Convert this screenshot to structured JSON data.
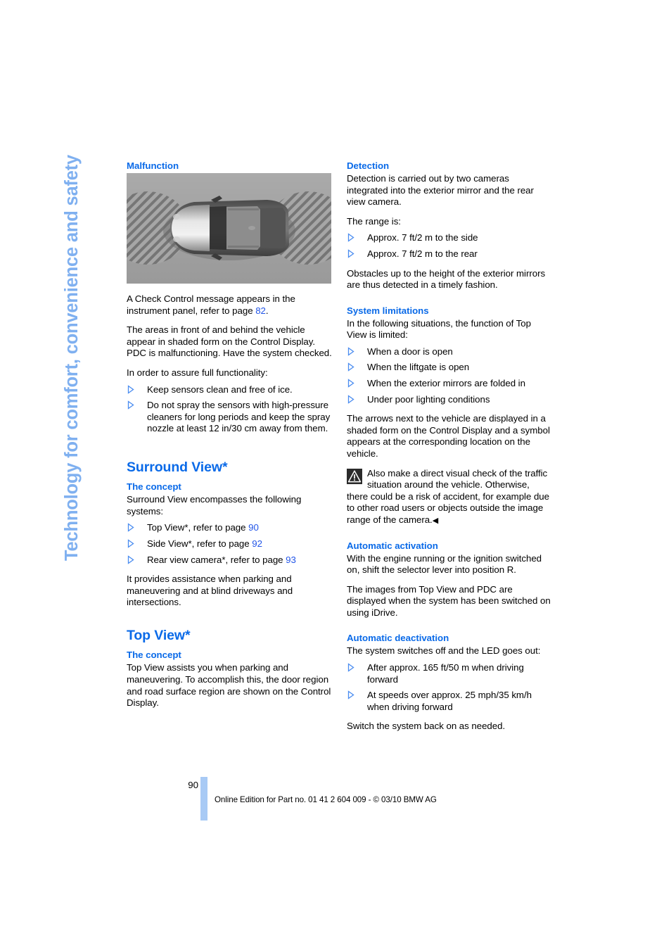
{
  "sidebar": {
    "chapter_title": "Technology for comfort, convenience and safety",
    "color": "#7fb0f0"
  },
  "theme": {
    "heading_blue": "#0a6ae8",
    "link_blue": "#2255e8",
    "folio_bar_blue": "#a8caf5"
  },
  "left_column": {
    "malfunction": {
      "heading": "Malfunction",
      "figure_alt": "Top-down view of vehicle with hatched detection zones in front and behind",
      "paragraph_1_pre": "A Check Control message appears in the instrument panel, refer to page ",
      "paragraph_1_link": "82",
      "paragraph_1_post": ".",
      "paragraph_2": "The areas in front of and behind the vehicle appear in shaded form on the Control Display. PDC is malfunctioning. Have the system checked.",
      "paragraph_3": "In order to assure full functionality:",
      "bullets": [
        "Keep sensors clean and free of ice.",
        "Do not spray the sensors with high-pressure cleaners for long periods and keep the spray nozzle at least 12 in/30 cm away from them."
      ]
    },
    "surround_view": {
      "heading": "Surround View*",
      "sub_heading": "The concept",
      "intro": "Surround View encompasses the following systems:",
      "bullets": [
        {
          "text_pre": "Top View*, refer to page ",
          "link": "90"
        },
        {
          "text_pre": "Side View*, refer to page ",
          "link": "92"
        },
        {
          "text_pre": "Rear view camera*, refer to page ",
          "link": "93"
        }
      ],
      "outro": "It provides assistance when parking and maneuvering and at blind driveways and intersections."
    },
    "top_view": {
      "heading": "Top View*",
      "sub_heading": "The concept",
      "paragraph": "Top View assists you when parking and maneuvering. To accomplish this, the door region and road surface region are shown on the Control Display."
    }
  },
  "right_column": {
    "detection": {
      "heading": "Detection",
      "paragraph_1": "Detection is carried out by two cameras integrated into the exterior mirror and the rear view camera.",
      "paragraph_2": "The range is:",
      "bullets": [
        "Approx. 7 ft/2 m to the side",
        "Approx. 7 ft/2 m to the rear"
      ],
      "paragraph_3": "Obstacles up to the height of the exterior mirrors are thus detected in a timely fashion."
    },
    "system_limitations": {
      "heading": "System limitations",
      "paragraph_1": "In the following situations, the function of Top View is limited:",
      "bullets": [
        "When a door is open",
        "When the liftgate is open",
        "When the exterior mirrors are folded in",
        "Under poor lighting conditions"
      ],
      "paragraph_2": "The arrows next to the vehicle are displayed in a shaded form on the Control Display and a symbol appears at the corresponding location on the vehicle.",
      "warning_text": "Also make a direct visual check of the traffic situation around the vehicle. Otherwise, there could be a risk of accident, for example due to other road users or objects outside the image range of the camera.",
      "warning_endmark": "◀"
    },
    "automatic_activation": {
      "heading": "Automatic activation",
      "paragraph_1": "With the engine running or the ignition switched on, shift the selector lever into position R.",
      "paragraph_2": "The images from Top View and PDC are displayed when the system has been switched on using iDrive."
    },
    "automatic_deactivation": {
      "heading": "Automatic deactivation",
      "paragraph_1": "The system switches off and the LED goes out:",
      "bullets": [
        "After approx. 165 ft/50 m when driving forward",
        "At speeds over approx. 25 mph/35 km/h when driving forward"
      ],
      "paragraph_2": "Switch the system back on as needed."
    }
  },
  "footer": {
    "page_number": "90",
    "imprint": "Online Edition for Part no. 01 41 2 604 009 - © 03/10 BMW AG"
  }
}
